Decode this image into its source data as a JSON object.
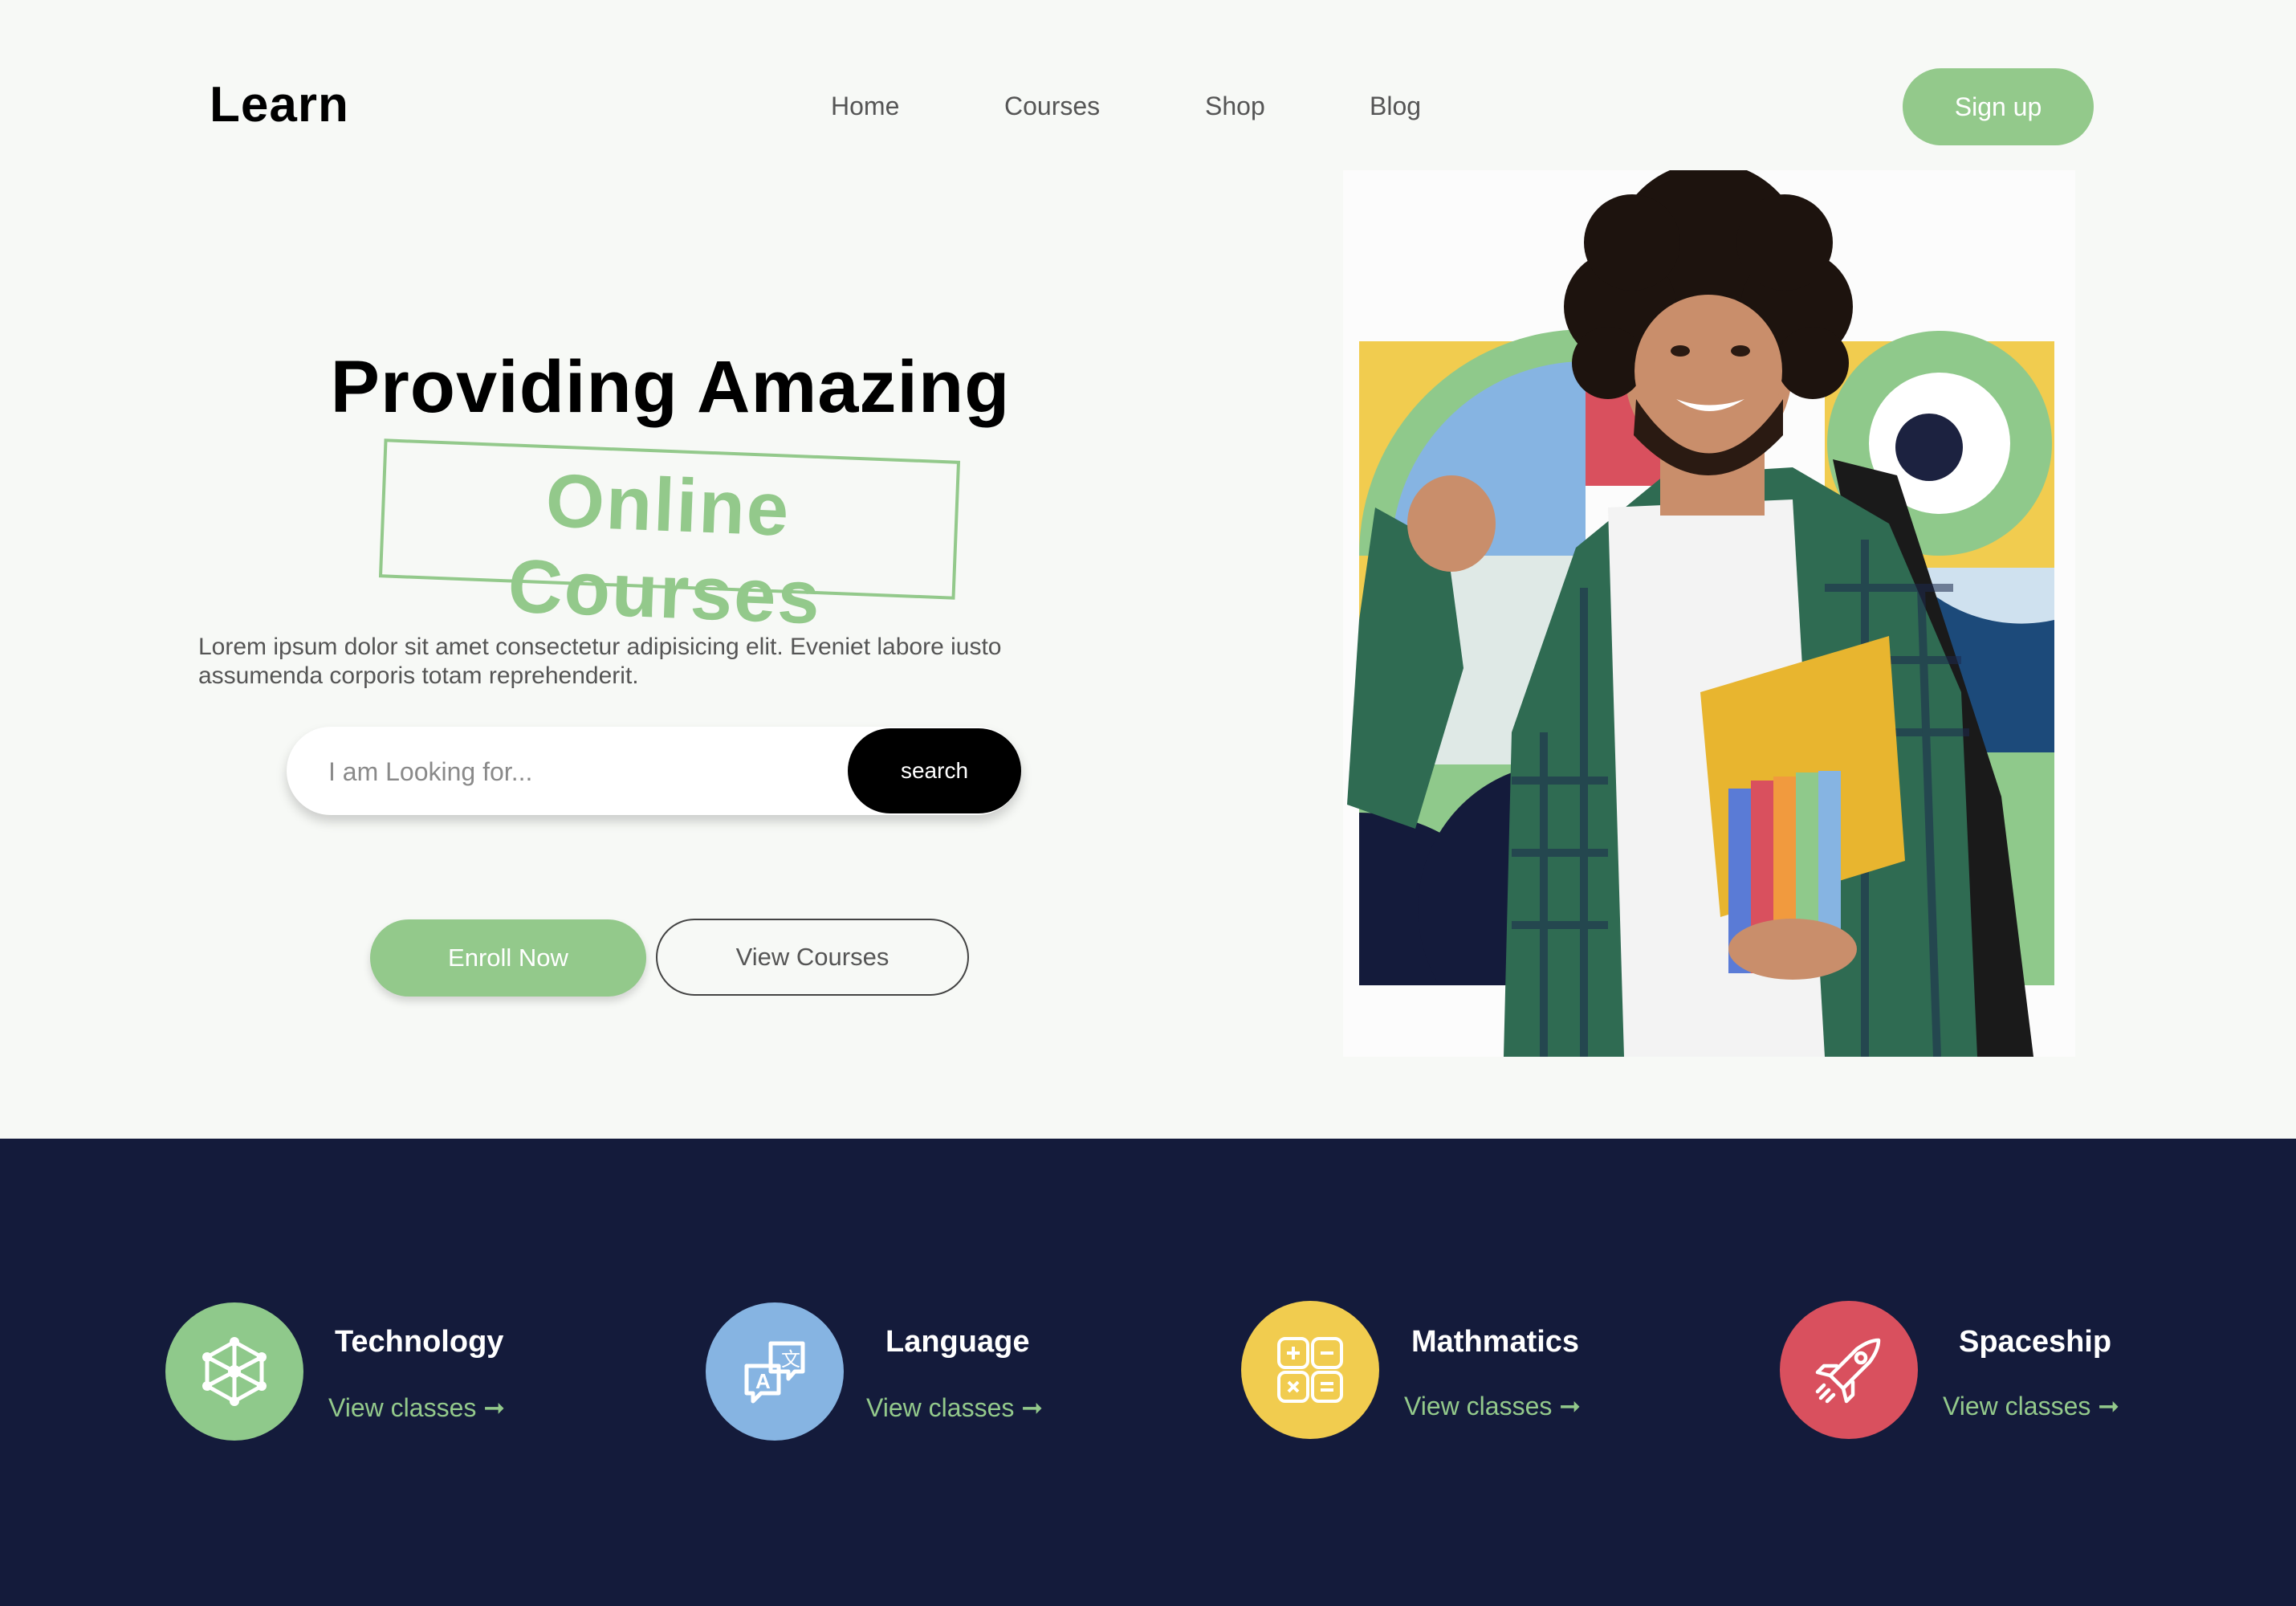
{
  "header": {
    "logo": "Learn",
    "nav": [
      "Home",
      "Courses",
      "Shop",
      "Blog"
    ],
    "signup_label": "Sign up"
  },
  "hero": {
    "headline": "Providing Amazing",
    "highlight": "Online Courses",
    "description_line1": "Lorem ipsum dolor sit amet consectetur adipisicing elit. Eveniet labore iusto",
    "description_line2": "assumenda corporis totam reprehenderit.",
    "search": {
      "placeholder": "I am Looking for...",
      "button_label": "search"
    },
    "enroll_label": "Enroll Now",
    "view_courses_label": "View Courses"
  },
  "categories": [
    {
      "title": "Technology",
      "link": "View classes ➞",
      "color": "#8fc98b",
      "icon": "molecule-icon"
    },
    {
      "title": "Language",
      "link": "View classes ➞",
      "color": "#86b4e2",
      "icon": "translate-icon"
    },
    {
      "title": "Mathmatics",
      "link": "View classes ➞",
      "color": "#f1cc4f",
      "icon": "calculator-icon"
    },
    {
      "title": "Spaceship",
      "link": "View classes ➞",
      "color": "#d9505e",
      "icon": "rocket-icon"
    }
  ],
  "colors": {
    "accent": "#93c98b",
    "band": "#141b3b",
    "link": "#93c98b"
  }
}
